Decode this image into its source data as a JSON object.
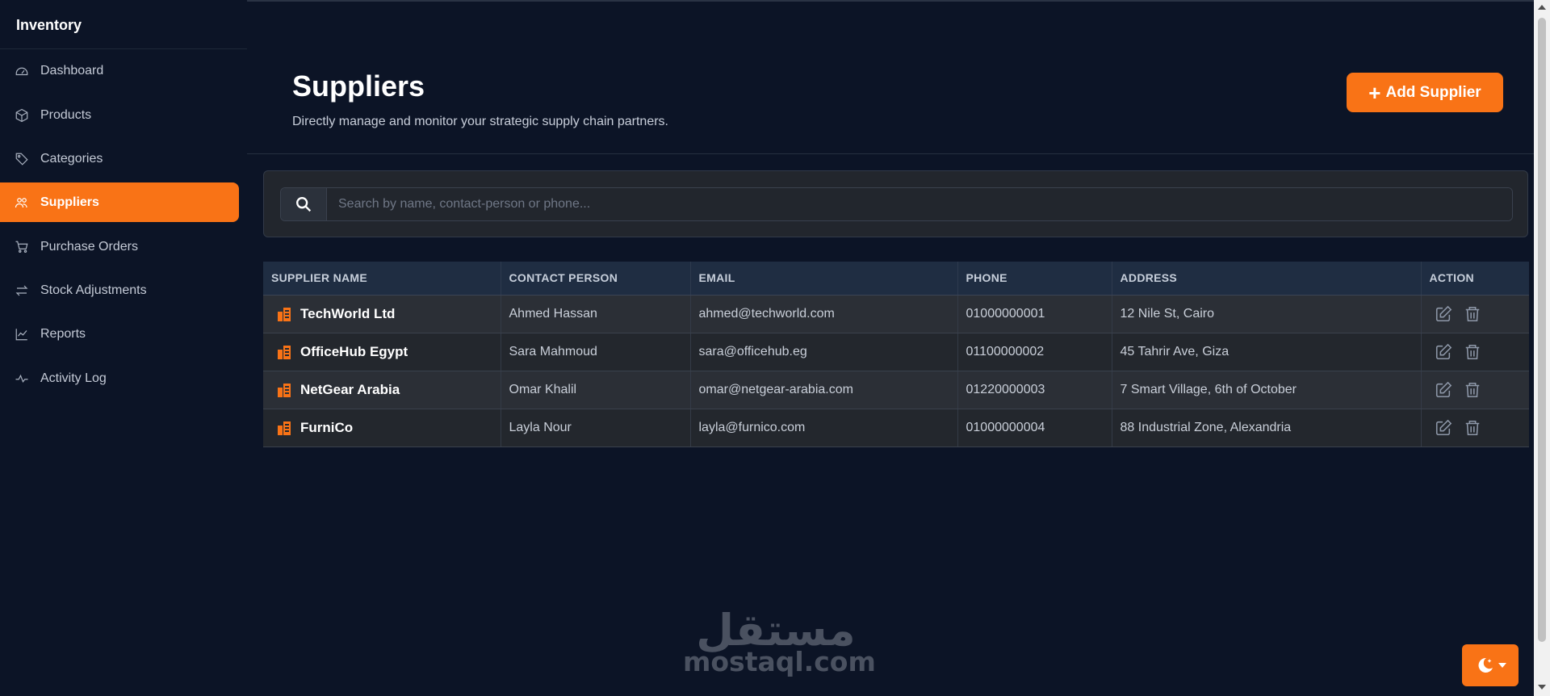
{
  "sidebar": {
    "brand": "Inventory",
    "items": [
      {
        "label": "Dashboard",
        "icon": "dashboard-icon"
      },
      {
        "label": "Products",
        "icon": "box-icon"
      },
      {
        "label": "Categories",
        "icon": "tag-icon"
      },
      {
        "label": "Suppliers",
        "icon": "users-icon",
        "active": true
      },
      {
        "label": "Purchase Orders",
        "icon": "cart-icon"
      },
      {
        "label": "Stock Adjustments",
        "icon": "arrows-icon"
      },
      {
        "label": "Reports",
        "icon": "chart-line-icon"
      },
      {
        "label": "Activity Log",
        "icon": "pulse-icon"
      }
    ]
  },
  "header": {
    "title": "Suppliers",
    "subtitle": "Directly manage and monitor your strategic supply chain partners.",
    "add_button_label": "Add Supplier",
    "add_button_icon": "plus-icon"
  },
  "search": {
    "placeholder": "Search by name, contact-person or phone...",
    "value": "",
    "icon": "search-icon"
  },
  "table": {
    "columns": [
      "SUPPLIER NAME",
      "CONTACT PERSON",
      "EMAIL",
      "PHONE",
      "ADDRESS",
      "ACTION"
    ],
    "rows": [
      {
        "name": "TechWorld Ltd",
        "contact": "Ahmed Hassan",
        "email": "ahmed@techworld.com",
        "phone": "01000000001",
        "address": "12 Nile St, Cairo"
      },
      {
        "name": "OfficeHub Egypt",
        "contact": "Sara Mahmoud",
        "email": "sara@officehub.eg",
        "phone": "01100000002",
        "address": "45 Tahrir Ave, Giza"
      },
      {
        "name": "NetGear Arabia",
        "contact": "Omar Khalil",
        "email": "omar@netgear-arabia.com",
        "phone": "01220000003",
        "address": "7 Smart Village, 6th of October"
      },
      {
        "name": "FurniCo",
        "contact": "Layla Nour",
        "email": "layla@furnico.com",
        "phone": "01000000004",
        "address": "88 Industrial Zone, Alexandria"
      }
    ],
    "row_icon": "building-icon",
    "action_icons": [
      "edit-icon",
      "trash-icon"
    ]
  },
  "watermark": {
    "arabic": "مستقل",
    "domain": "mostaql.com"
  },
  "theme_toggle": {
    "icon": "moon-stars-icon"
  },
  "colors": {
    "accent": "#f97316",
    "background": "#0c1426",
    "table_header": "#1f2d42"
  }
}
